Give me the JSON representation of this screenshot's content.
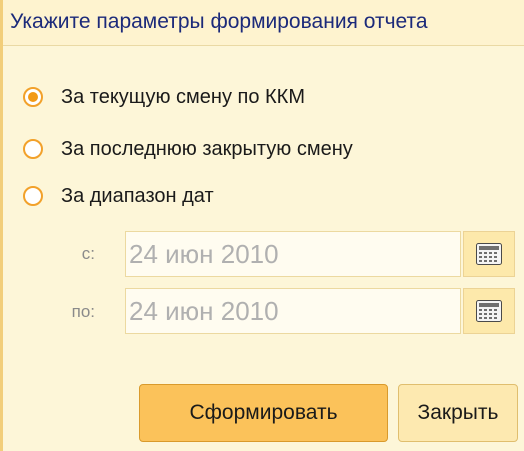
{
  "header": {
    "title": "Укажите параметры формирования отчета"
  },
  "options": [
    {
      "label": "За текущую смену по ККМ",
      "checked": true
    },
    {
      "label": "За последнюю закрытую смену",
      "checked": false
    },
    {
      "label": "За диапазон дат",
      "checked": false
    }
  ],
  "date_from": {
    "label": "с:",
    "value": "24 июн 2010",
    "icon": "calendar-icon"
  },
  "date_to": {
    "label": "по:",
    "value": "24 июн 2010",
    "icon": "calendar-icon"
  },
  "buttons": {
    "generate_label": "Сформировать",
    "close_label": "Закрыть"
  },
  "colors": {
    "background": "#fdf6d8",
    "accent": "#f29a16",
    "title": "#1c2a7a",
    "primary_button": "#fbc25a"
  }
}
